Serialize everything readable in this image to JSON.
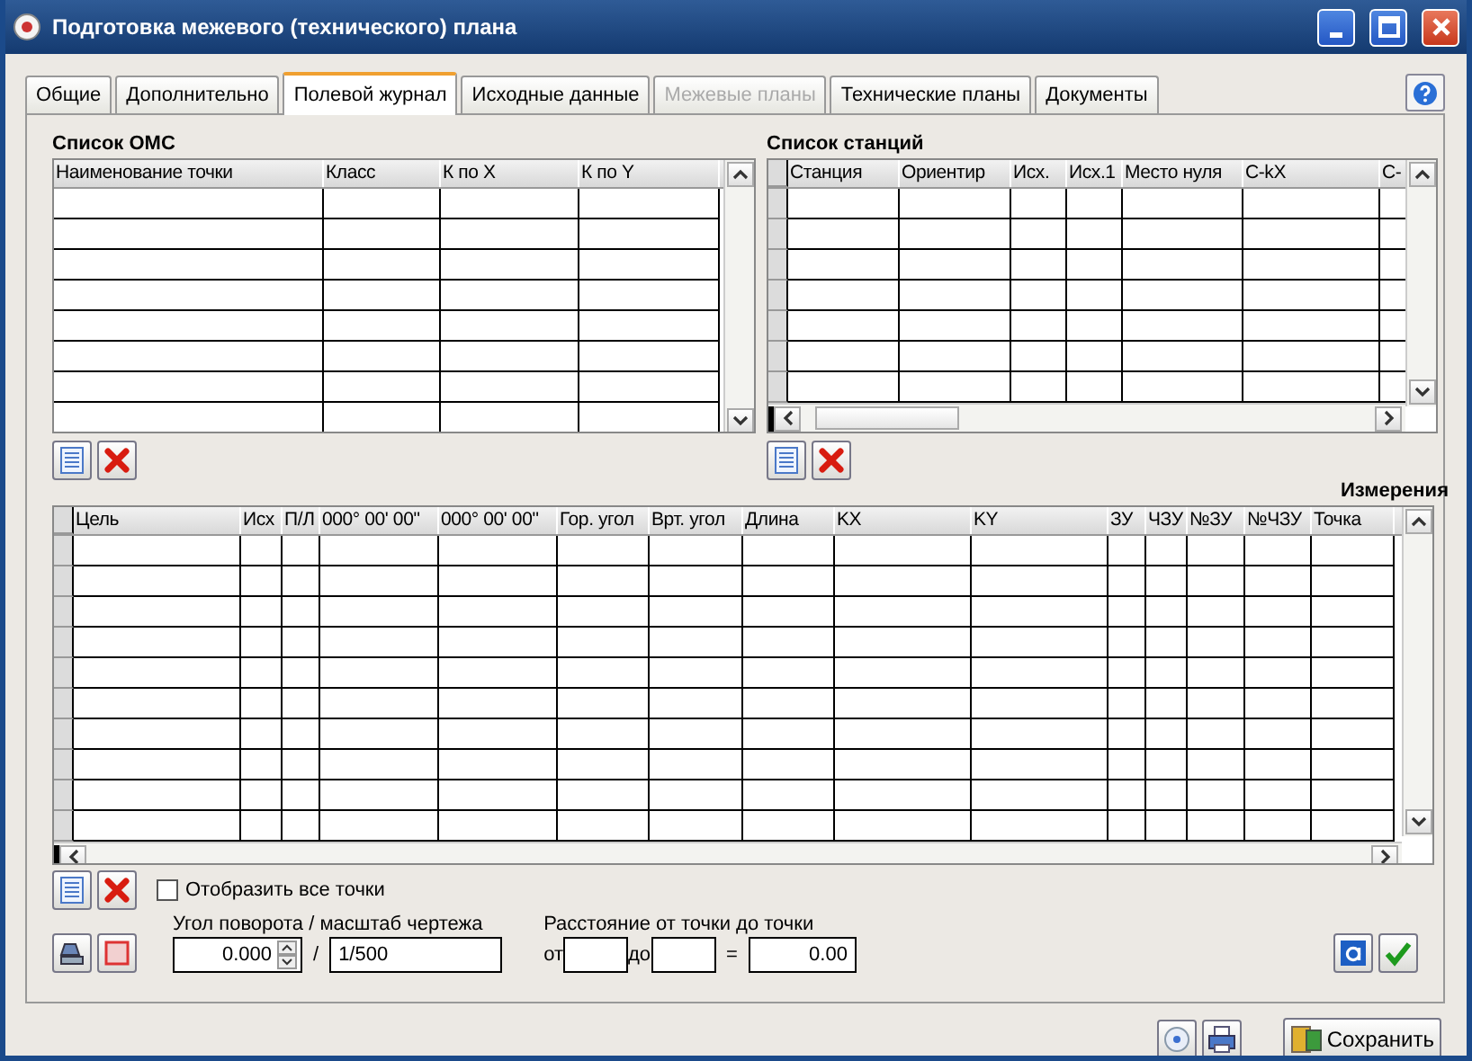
{
  "window": {
    "title": "Подготовка межевого (технического) плана"
  },
  "tabs": [
    {
      "label": "Общие",
      "selected": false,
      "disabled": false
    },
    {
      "label": "Дополнительно",
      "selected": false,
      "disabled": false
    },
    {
      "label": "Полевой журнал",
      "selected": true,
      "disabled": false
    },
    {
      "label": "Исходные данные",
      "selected": false,
      "disabled": false
    },
    {
      "label": "Межевые планы",
      "selected": false,
      "disabled": true
    },
    {
      "label": "Технические планы",
      "selected": false,
      "disabled": false
    },
    {
      "label": "Документы",
      "selected": false,
      "disabled": false
    }
  ],
  "oms_list": {
    "title": "Список ОМС",
    "columns": [
      "Наименование точки",
      "Класс",
      "К по X",
      "К по Y"
    ]
  },
  "station_list": {
    "title": "Список станций",
    "columns": [
      "Станция",
      "Ориентир",
      "Исх.",
      "Исх.1",
      "Место нуля",
      "С-kX",
      "С-"
    ]
  },
  "measurements": {
    "title": "Измерения",
    "columns": [
      "Цель",
      "Исх",
      "П/Л",
      "000° 00' 00\"",
      "000° 00' 00\"",
      "Гор. угол",
      "Врт. угол",
      "Длина",
      "KX",
      "KY",
      "ЗУ",
      "ЧЗУ",
      "№ЗУ",
      "№ЧЗУ",
      "Точка"
    ]
  },
  "show_all_points": {
    "label": "Отобразить все точки",
    "checked": false
  },
  "rotation": {
    "label": "Угол поворота / масштаб чертежа",
    "angle": "0.000",
    "separator": "/",
    "scale": "1/500"
  },
  "distance": {
    "label": "Расстояние от точки до точки",
    "from_label": "от",
    "to_label": "до",
    "equals": "=",
    "result": "0.00"
  },
  "save_button": {
    "label": "Сохранить"
  }
}
